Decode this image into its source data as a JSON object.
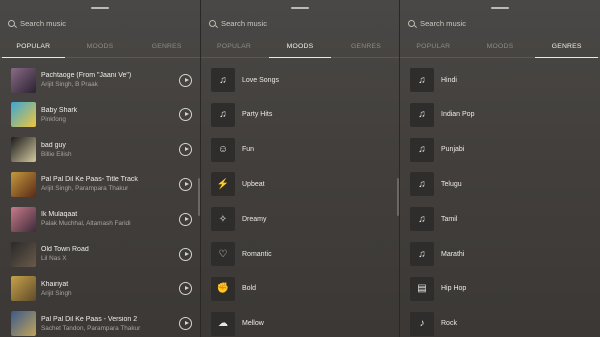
{
  "panels": [
    {
      "search_placeholder": "Search music",
      "tabs": [
        "POPULAR",
        "MOODS",
        "GENRES"
      ],
      "active_tab": "POPULAR",
      "songs": [
        {
          "title": "Pachtaoge (From \"Jaani Ve\")",
          "artist": "Arijit Singh, B Praak",
          "colors": [
            "#8a6a86",
            "#2a2230"
          ]
        },
        {
          "title": "Baby Shark",
          "artist": "Pinkfong",
          "colors": [
            "#39a7d6",
            "#f2c53a"
          ]
        },
        {
          "title": "bad guy",
          "artist": "Billie Eilish",
          "colors": [
            "#1c1c1c",
            "#d4c9a0"
          ]
        },
        {
          "title": "Pal Pal Dil Ke Paas- Title Track",
          "artist": "Arijit Singh, Parampara Thakur",
          "colors": [
            "#c59a3c",
            "#5a2a18"
          ]
        },
        {
          "title": "Ik Mulaqaat",
          "artist": "Palak Muchhal, Altamash Faridi",
          "colors": [
            "#c77b8a",
            "#3e2a3a"
          ]
        },
        {
          "title": "Old Town Road",
          "artist": "Lil Nas X",
          "colors": [
            "#2a2a2a",
            "#6a5a4a"
          ]
        },
        {
          "title": "Khairiyat",
          "artist": "Arijit Singh",
          "colors": [
            "#c7a24a",
            "#5e4a2a"
          ]
        },
        {
          "title": "Pal Pal Dil Ke Paas - Version 2",
          "artist": "Sachet Tandon, Parampara Thakur",
          "colors": [
            "#3a5a8a",
            "#c1a45a"
          ]
        }
      ]
    },
    {
      "search_placeholder": "Search music",
      "tabs": [
        "POPULAR",
        "MOODS",
        "GENRES"
      ],
      "active_tab": "MOODS",
      "categories": [
        {
          "label": "Love Songs",
          "icon": "music-note-icon",
          "glyph": "♫"
        },
        {
          "label": "Party Hits",
          "icon": "music-note-icon",
          "glyph": "♫"
        },
        {
          "label": "Fun",
          "icon": "fun-icon",
          "glyph": "☺"
        },
        {
          "label": "Upbeat",
          "icon": "upbeat-icon",
          "glyph": "⚡"
        },
        {
          "label": "Dreamy",
          "icon": "dreamy-icon",
          "glyph": "✧"
        },
        {
          "label": "Romantic",
          "icon": "heart-icon",
          "glyph": "♡"
        },
        {
          "label": "Bold",
          "icon": "bold-icon",
          "glyph": "✊"
        },
        {
          "label": "Mellow",
          "icon": "mellow-icon",
          "glyph": "☁"
        }
      ]
    },
    {
      "search_placeholder": "Search music",
      "tabs": [
        "POPULAR",
        "MOODS",
        "GENRES"
      ],
      "active_tab": "GENRES",
      "categories": [
        {
          "label": "Hindi",
          "icon": "music-note-icon",
          "glyph": "♫"
        },
        {
          "label": "Indian Pop",
          "icon": "music-note-icon",
          "glyph": "♫"
        },
        {
          "label": "Punjabi",
          "icon": "music-note-icon",
          "glyph": "♫"
        },
        {
          "label": "Telugu",
          "icon": "music-note-icon",
          "glyph": "♫"
        },
        {
          "label": "Tamil",
          "icon": "music-note-icon",
          "glyph": "♫"
        },
        {
          "label": "Marathi",
          "icon": "music-note-icon",
          "glyph": "♫"
        },
        {
          "label": "Hip Hop",
          "icon": "boombox-icon",
          "glyph": "▤"
        },
        {
          "label": "Rock",
          "icon": "guitar-icon",
          "glyph": "♪"
        }
      ]
    }
  ]
}
